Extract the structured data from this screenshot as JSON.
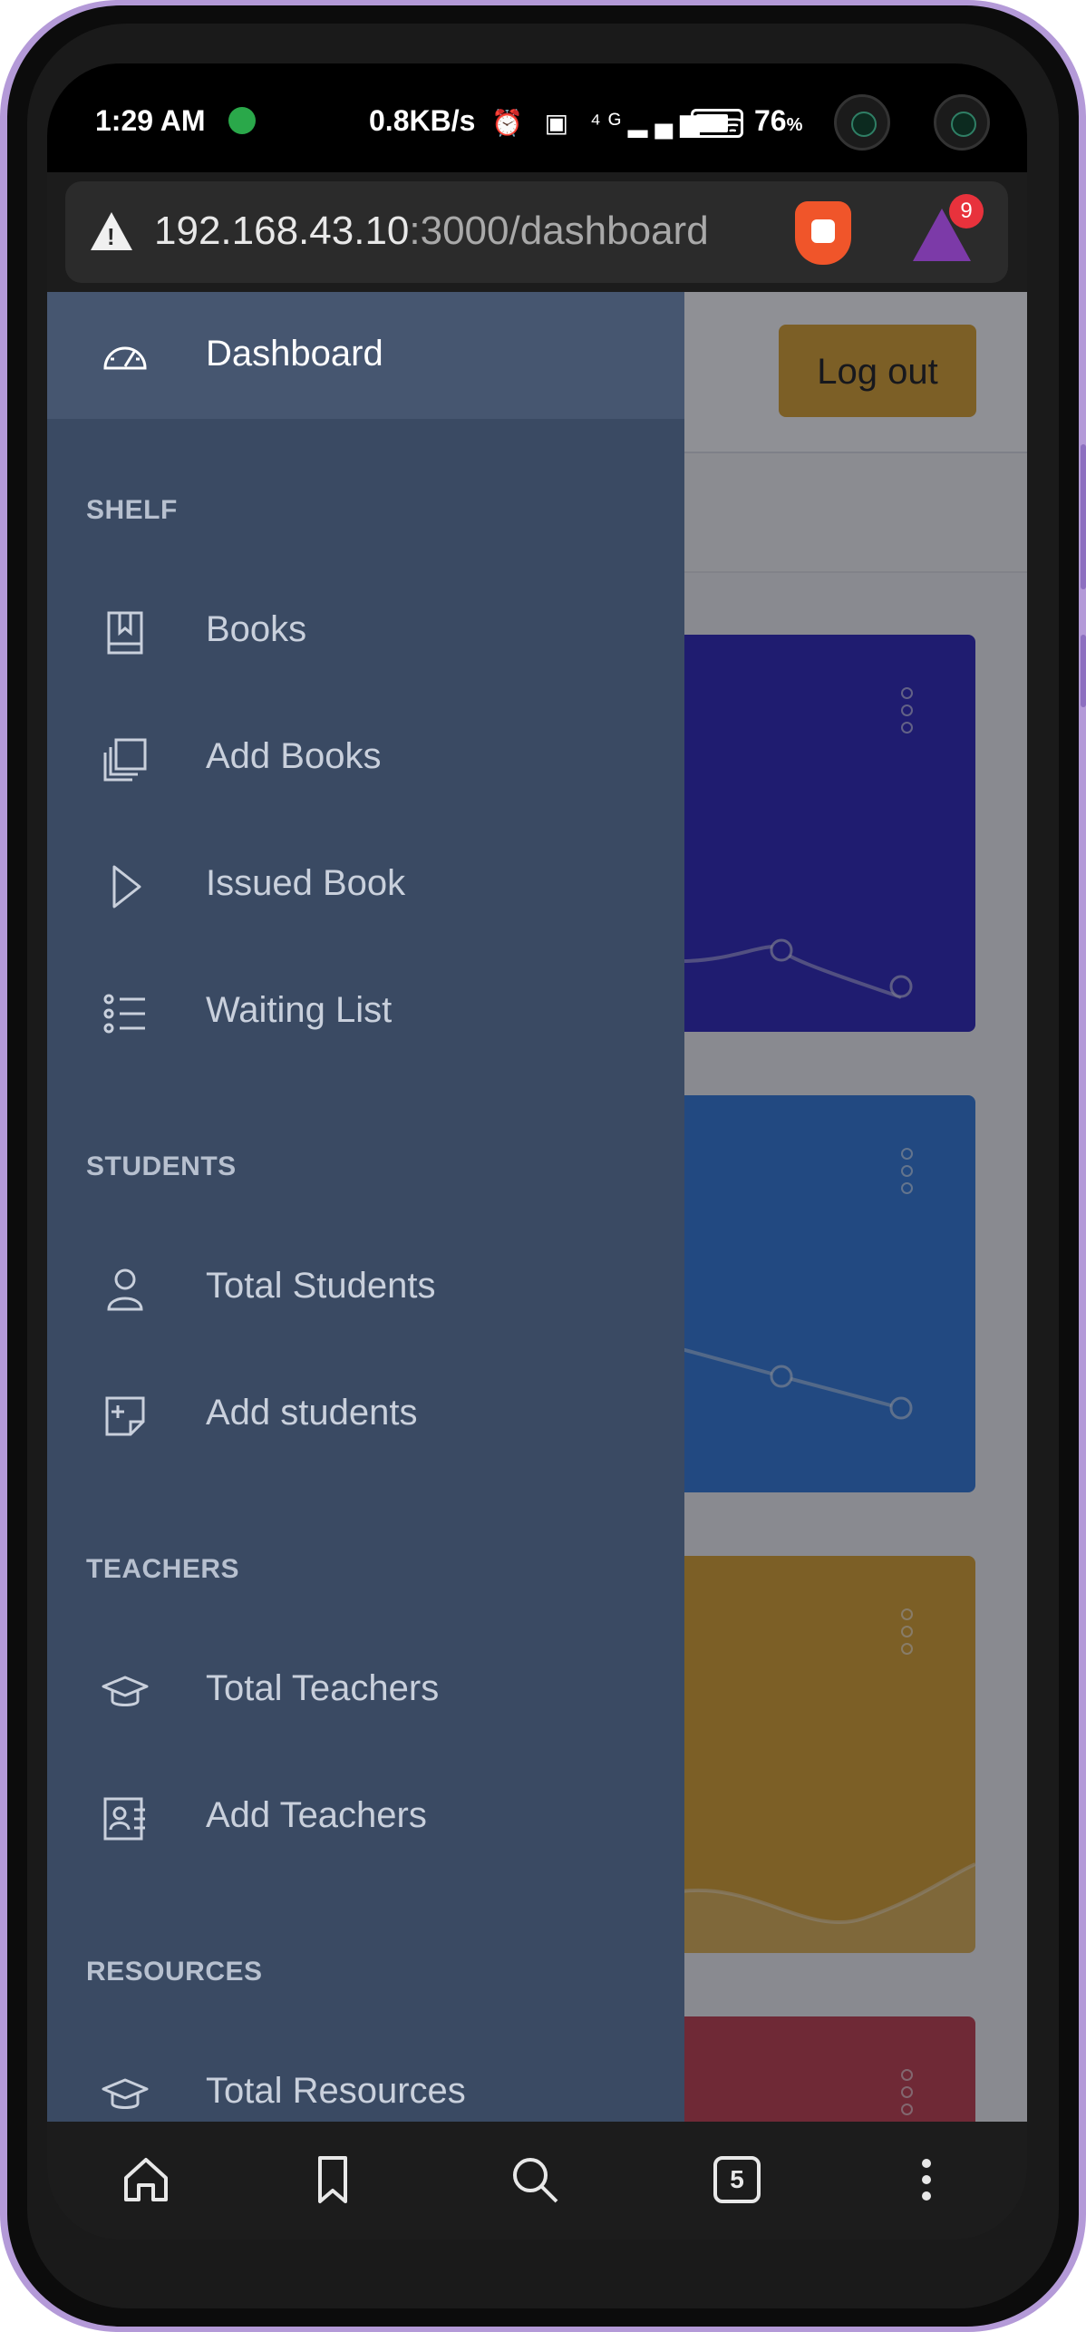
{
  "status_bar": {
    "time": "1:29 AM",
    "net_speed": "0.8KB/s",
    "indicators": "⏰ ▣ ⁴ᴳ▂▄▆ ᯤ",
    "battery_level": 0.76,
    "battery_pct": "76"
  },
  "browser": {
    "url_host": "192.168.43.10",
    "url_path": ":3000/dashboard",
    "rewards_count": "9",
    "tab_count": "5"
  },
  "header": {
    "logout_label": "Log out"
  },
  "colors": {
    "sidebar": "#3a4a63",
    "card_1": "#2a22b8",
    "card_2": "#2f78d8",
    "card_3": "#dba12b",
    "card_4": "#c23a4a"
  },
  "sidebar": {
    "dashboard": "Dashboard",
    "sections": {
      "shelf": "SHELF",
      "students": "STUDENTS",
      "teachers": "TEACHERS",
      "resources": "RESOURCES"
    },
    "items": {
      "books": "Books",
      "add_books": "Add Books",
      "issued_book": "Issued Book",
      "waiting_list": "Waiting List",
      "total_students": "Total Students",
      "add_students": "Add students",
      "total_teachers": "Total Teachers",
      "add_teachers": "Add Teachers",
      "total_resources": "Total Resources"
    }
  }
}
